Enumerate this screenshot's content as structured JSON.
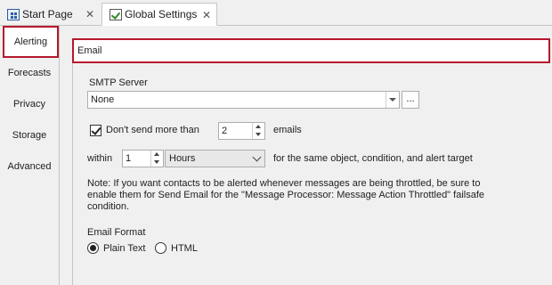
{
  "tabs": [
    {
      "label": "Start Page",
      "icon": "start-page-icon"
    },
    {
      "label": "Global Settings",
      "icon": "settings-check-icon"
    }
  ],
  "nav": {
    "items": [
      "Alerting",
      "Forecasts",
      "Privacy",
      "Storage",
      "Advanced"
    ],
    "active": "Alerting"
  },
  "email": {
    "header": "Email",
    "smtp_label": "SMTP Server",
    "smtp_value": "None",
    "smtp_browse": "...",
    "throttle_checkbox_label": "Don't send more than",
    "throttle_checked": true,
    "throttle_count": "2",
    "throttle_unit": "emails",
    "within_label": "within",
    "within_value": "1",
    "within_unit": "Hours",
    "within_suffix": "for the same object, condition, and alert target",
    "note": "Note:  If you want contacts to be alerted whenever messages are being throttled, be sure to enable them for Send Email for the \"Message Processor: Message Action Throttled\" failsafe condition.",
    "format_label": "Email Format",
    "format_options": [
      "Plain Text",
      "HTML"
    ],
    "format_selected": "Plain Text"
  },
  "colors": {
    "highlight": "#b5182d"
  }
}
